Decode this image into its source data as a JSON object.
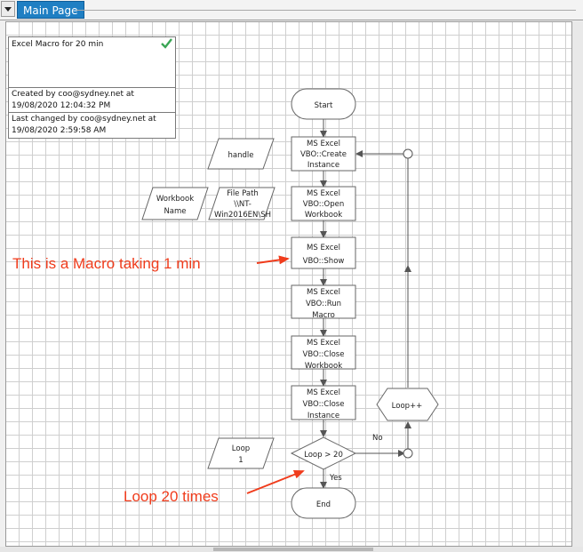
{
  "tabs": [
    {
      "label": "Main Page"
    }
  ],
  "info": {
    "title": "Excel Macro for 20 min",
    "created_line1": "Created by coo@sydney.net at",
    "created_line2": "19/08/2020 12:04:32 PM",
    "changed_line1": "Last changed by coo@sydney.net at",
    "changed_line2": "19/08/2020 2:59:58 AM"
  },
  "flow": {
    "start": "Start",
    "create": [
      "MS Excel",
      "VBO::Create",
      "Instance"
    ],
    "open": [
      "MS Excel",
      "VBO::Open",
      "Workbook"
    ],
    "show": [
      "MS Excel",
      "VBO::Show"
    ],
    "run": [
      "MS Excel",
      "VBO::Run",
      "Macro"
    ],
    "closewb": [
      "MS Excel",
      "VBO::Close",
      "Workbook"
    ],
    "closeinst": [
      "MS Excel",
      "VBO::Close",
      "Instance"
    ],
    "decision": "Loop > 20",
    "yes": "Yes",
    "no": "No",
    "loop": "Loop++",
    "end": "End",
    "handle": "handle",
    "wbname": [
      "Workbook",
      "Name"
    ],
    "filepath": [
      "File Path",
      "\\\\NT-",
      "Win2016EN\\SH"
    ],
    "loopvar": [
      "Loop",
      "1"
    ]
  },
  "annotations": {
    "macro": "This is a Macro taking 1 min",
    "loop": "Loop 20 times"
  },
  "colors": {
    "annotation": "#f03c1c",
    "tab": "#1f7fc3"
  }
}
